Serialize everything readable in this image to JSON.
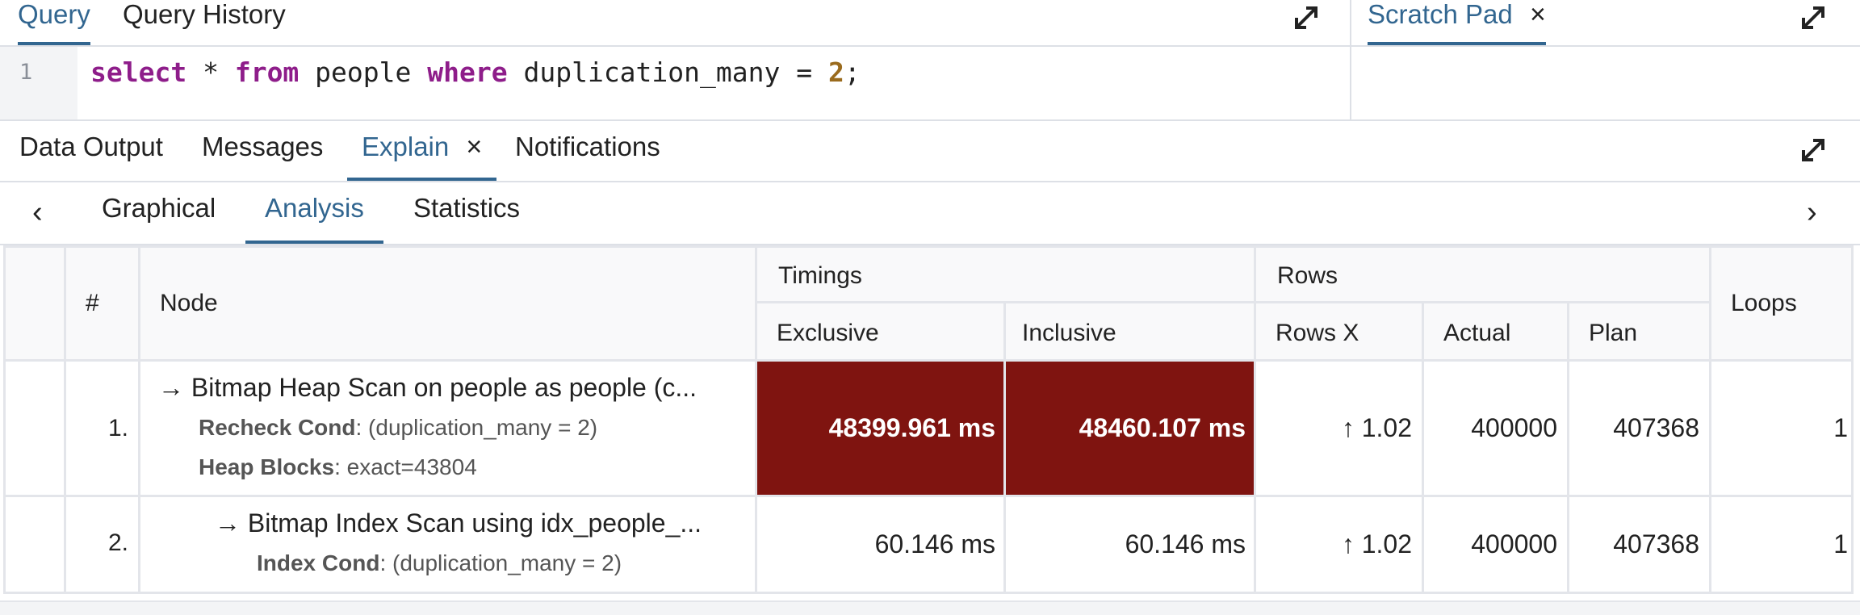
{
  "query_tabs": [
    {
      "label": "Query",
      "active": true
    },
    {
      "label": "Query History",
      "active": false
    }
  ],
  "scratch_pad": {
    "label": "Scratch Pad",
    "close": "×"
  },
  "editor": {
    "line_number": "1",
    "tokens": {
      "t1": "select",
      "t2": " * ",
      "t3": "from",
      "t4": " people ",
      "t5": "where",
      "t6": " duplication_many = ",
      "t7": "2",
      "t8": ";"
    }
  },
  "result_tabs": [
    {
      "label": "Data Output",
      "active": false
    },
    {
      "label": "Messages",
      "active": false
    },
    {
      "label": "Explain",
      "active": true,
      "close": "×"
    },
    {
      "label": "Notifications",
      "active": false
    }
  ],
  "explain_tabs": [
    {
      "label": "Graphical",
      "active": false
    },
    {
      "label": "Analysis",
      "active": true
    },
    {
      "label": "Statistics",
      "active": false
    }
  ],
  "nav": {
    "prev": "‹",
    "next": "›"
  },
  "table": {
    "headers": {
      "num": "#",
      "node": "Node",
      "timings": "Timings",
      "exclusive": "Exclusive",
      "inclusive": "Inclusive",
      "rows": "Rows",
      "rows_x": "Rows X",
      "actual": "Actual",
      "plan": "Plan",
      "loops": "Loops"
    },
    "rows": [
      {
        "num": "1.",
        "arrow": "→",
        "node": "Bitmap Heap Scan on people as people (c...",
        "d1_label": "Recheck Cond",
        "d1_value": ": (duplication_many = 2)",
        "d2_label": "Heap Blocks",
        "d2_value": ": exact=43804",
        "exclusive": "48399.961 ms",
        "inclusive": "48460.107 ms",
        "rows_x": "↑ 1.02",
        "actual": "400000",
        "plan": "407368",
        "loops": "1"
      },
      {
        "num": "2.",
        "arrow": "→",
        "node": "Bitmap Index Scan using idx_people_...",
        "d1_label": "Index Cond",
        "d1_value": ": (duplication_many = 2)",
        "exclusive": "60.146 ms",
        "inclusive": "60.146 ms",
        "rows_x": "↑ 1.02",
        "actual": "400000",
        "plan": "407368",
        "loops": "1"
      }
    ]
  },
  "colors": {
    "accent": "#326690",
    "hot_cell": "#7f1410",
    "keyword": "#8e1d8a",
    "number": "#9a6b1d"
  }
}
